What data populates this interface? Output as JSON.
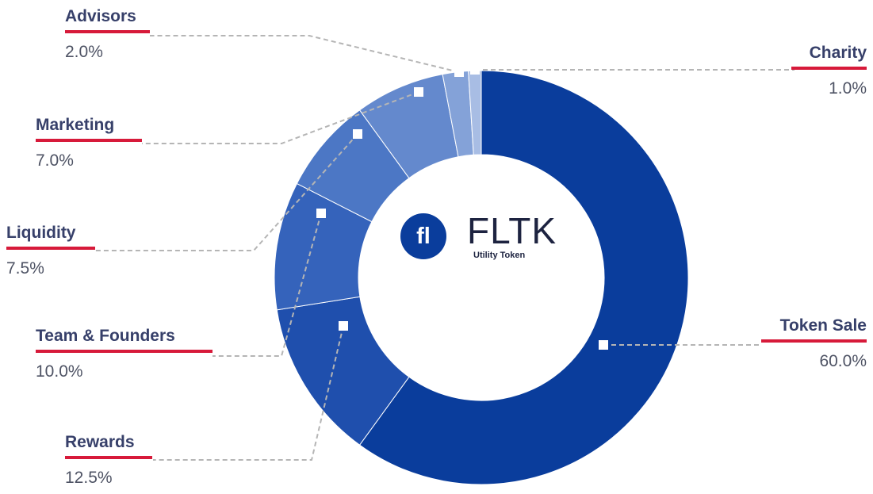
{
  "chart_data": {
    "type": "pie",
    "center_title": "FLTK",
    "center_subtitle": "Utility Token",
    "logo_text": "fl",
    "slices": [
      {
        "label": "Token Sale",
        "value": 60.0,
        "value_label": "60.0%",
        "color": "#0a3d9c"
      },
      {
        "label": "Rewards",
        "value": 12.5,
        "value_label": "12.5%",
        "color": "#1f4fad"
      },
      {
        "label": "Team & Founders",
        "value": 10.0,
        "value_label": "10.0%",
        "color": "#3563bb"
      },
      {
        "label": "Liquidity",
        "value": 7.5,
        "value_label": "7.5%",
        "color": "#4c77c5"
      },
      {
        "label": "Marketing",
        "value": 7.0,
        "value_label": "7.0%",
        "color": "#6489cd"
      },
      {
        "label": "Advisors",
        "value": 2.0,
        "value_label": "2.0%",
        "color": "#84a2d8"
      },
      {
        "label": "Charity",
        "value": 1.0,
        "value_label": "1.0%",
        "color": "#a8bde4"
      }
    ]
  },
  "colors": {
    "accent_bar": "#d71a3a",
    "leader_line": "#b5b5b5"
  }
}
